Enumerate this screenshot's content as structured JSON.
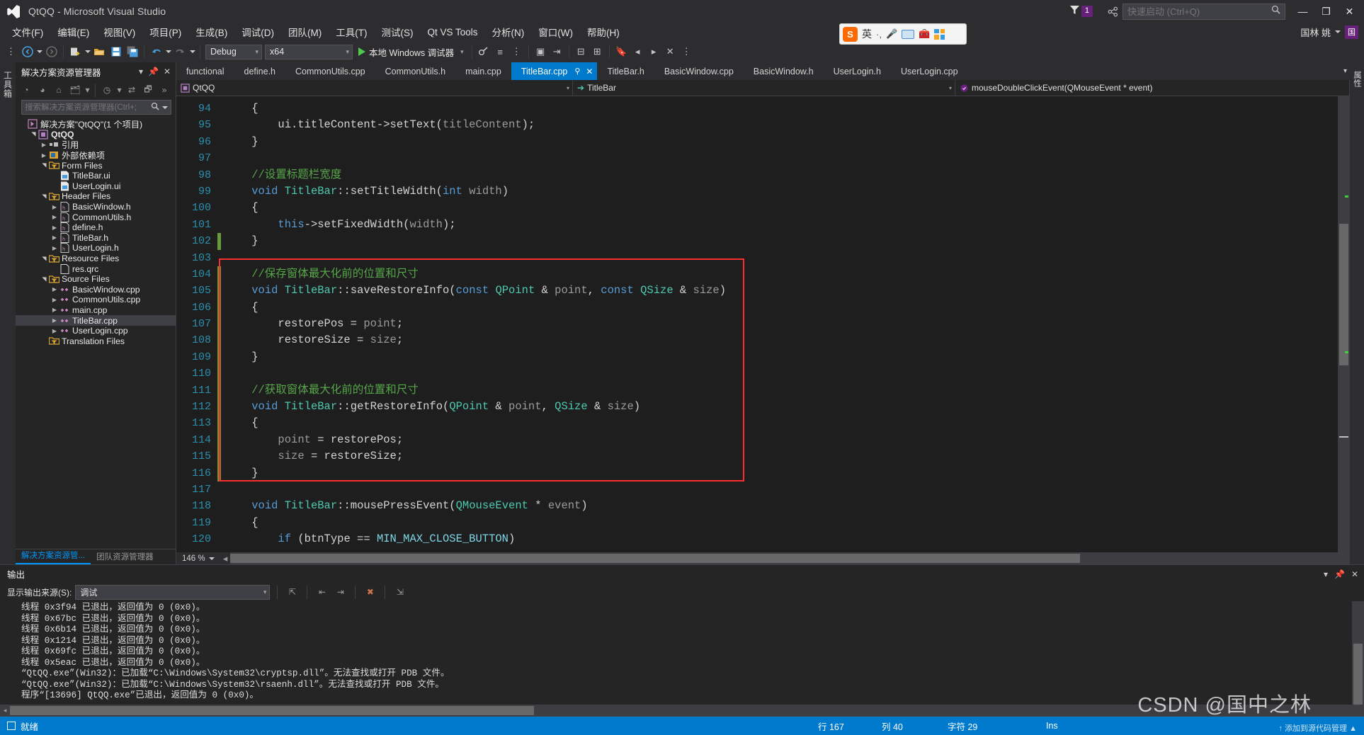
{
  "window": {
    "title": "QtQQ - Microsoft Visual Studio",
    "logo_icon": "visual-studio-logo",
    "minimize_label": "—",
    "restore_label": "❐",
    "close_label": "✕"
  },
  "notifications": {
    "icon": "feedback-flag-icon",
    "count": "1",
    "share_icon": "share-icon"
  },
  "quick_launch": {
    "placeholder": "快速启动 (Ctrl+Q)",
    "value": "",
    "icon": "search-icon"
  },
  "menu": {
    "items": [
      "文件(F)",
      "编辑(E)",
      "视图(V)",
      "项目(P)",
      "生成(B)",
      "调试(D)",
      "团队(M)",
      "工具(T)",
      "测试(S)",
      "Qt VS Tools",
      "分析(N)",
      "窗口(W)",
      "帮助(H)"
    ]
  },
  "account": {
    "name": "国林 姚",
    "avatar_initial": "国"
  },
  "toolbar": {
    "nav_back_icon": "navigate-back-icon",
    "nav_forward_icon": "navigate-forward-icon",
    "new_project_icon": "new-project-icon",
    "open_file_icon": "open-file-icon",
    "save_icon": "save-icon",
    "save_all_icon": "save-all-icon",
    "undo_icon": "undo-icon",
    "redo_icon": "redo-icon",
    "config_value": "Debug",
    "platform_value": "x64",
    "run_label": "本地 Windows 调试器",
    "run_icon": "play-icon"
  },
  "ime": {
    "engine": "搜狗输入法",
    "mode": "英",
    "logo_text": "S",
    "icons": [
      "mic-icon",
      "keyboard-icon",
      "toolbox-icon",
      "apps-icon"
    ]
  },
  "left_rail": {
    "label": "工具箱"
  },
  "right_rail": {
    "label": "属性"
  },
  "solution_explorer": {
    "title": "解决方案资源管理器",
    "header_icons": [
      "chevron-down-icon",
      "pin-icon",
      "close-icon"
    ],
    "toolbar_icons": [
      "back-icon",
      "forward-icon",
      "home-icon",
      "folder-view-icon",
      "pending-changes-icon",
      "sync-icon",
      "properties-icon",
      "overflow-icon"
    ],
    "search": {
      "placeholder": "搜索解决方案资源管理器(Ctrl+;",
      "value": "",
      "icon": "search-icon"
    },
    "tree": [
      {
        "label": "解决方案\"QtQQ\"(1 个项目)",
        "depth": 0,
        "arrow": "none",
        "icon": "solution-icon",
        "bold": false,
        "selected": false
      },
      {
        "label": "QtQQ",
        "depth": 1,
        "arrow": "open",
        "icon": "project-icon",
        "bold": true,
        "selected": false
      },
      {
        "label": "引用",
        "depth": 2,
        "arrow": "closed",
        "icon": "references-icon",
        "bold": false,
        "selected": false
      },
      {
        "label": "外部依赖项",
        "depth": 2,
        "arrow": "closed",
        "icon": "external-deps-icon",
        "bold": false,
        "selected": false
      },
      {
        "label": "Form Files",
        "depth": 2,
        "arrow": "open",
        "icon": "filter-folder-icon",
        "bold": false,
        "selected": false
      },
      {
        "label": "TitleBar.ui",
        "depth": 3,
        "arrow": "none",
        "icon": "ui-file-icon",
        "bold": false,
        "selected": false
      },
      {
        "label": "UserLogin.ui",
        "depth": 3,
        "arrow": "none",
        "icon": "ui-file-icon",
        "bold": false,
        "selected": false
      },
      {
        "label": "Header Files",
        "depth": 2,
        "arrow": "open",
        "icon": "filter-folder-icon",
        "bold": false,
        "selected": false
      },
      {
        "label": "BasicWindow.h",
        "depth": 3,
        "arrow": "closed",
        "icon": "h-file-icon",
        "bold": false,
        "selected": false
      },
      {
        "label": "CommonUtils.h",
        "depth": 3,
        "arrow": "closed",
        "icon": "h-file-icon",
        "bold": false,
        "selected": false
      },
      {
        "label": "define.h",
        "depth": 3,
        "arrow": "closed",
        "icon": "h-file-icon",
        "bold": false,
        "selected": false
      },
      {
        "label": "TitleBar.h",
        "depth": 3,
        "arrow": "closed",
        "icon": "h-file-icon",
        "bold": false,
        "selected": false
      },
      {
        "label": "UserLogin.h",
        "depth": 3,
        "arrow": "closed",
        "icon": "h-file-icon",
        "bold": false,
        "selected": false
      },
      {
        "label": "Resource Files",
        "depth": 2,
        "arrow": "open",
        "icon": "filter-folder-icon",
        "bold": false,
        "selected": false
      },
      {
        "label": "res.qrc",
        "depth": 3,
        "arrow": "none",
        "icon": "qrc-file-icon",
        "bold": false,
        "selected": false
      },
      {
        "label": "Source Files",
        "depth": 2,
        "arrow": "open",
        "icon": "filter-folder-icon",
        "bold": false,
        "selected": false
      },
      {
        "label": "BasicWindow.cpp",
        "depth": 3,
        "arrow": "closed",
        "icon": "cpp-file-icon",
        "bold": false,
        "selected": false
      },
      {
        "label": "CommonUtils.cpp",
        "depth": 3,
        "arrow": "closed",
        "icon": "cpp-file-icon",
        "bold": false,
        "selected": false
      },
      {
        "label": "main.cpp",
        "depth": 3,
        "arrow": "closed",
        "icon": "cpp-file-icon",
        "bold": false,
        "selected": false
      },
      {
        "label": "TitleBar.cpp",
        "depth": 3,
        "arrow": "closed",
        "icon": "cpp-file-icon",
        "bold": false,
        "selected": true
      },
      {
        "label": "UserLogin.cpp",
        "depth": 3,
        "arrow": "closed",
        "icon": "cpp-file-icon",
        "bold": false,
        "selected": false
      },
      {
        "label": "Translation Files",
        "depth": 2,
        "arrow": "none",
        "icon": "filter-folder-icon",
        "bold": false,
        "selected": false
      }
    ],
    "bottom_tabs": [
      {
        "label": "解决方案资源管...",
        "active": true
      },
      {
        "label": "团队资源管理器",
        "active": false
      }
    ]
  },
  "editor": {
    "tabs": [
      {
        "label": "functional",
        "active": false
      },
      {
        "label": "define.h",
        "active": false
      },
      {
        "label": "CommonUtils.cpp",
        "active": false
      },
      {
        "label": "CommonUtils.h",
        "active": false
      },
      {
        "label": "main.cpp",
        "active": false
      },
      {
        "label": "TitleBar.cpp",
        "active": true
      },
      {
        "label": "TitleBar.h",
        "active": false
      },
      {
        "label": "BasicWindow.cpp",
        "active": false
      },
      {
        "label": "BasicWindow.h",
        "active": false
      },
      {
        "label": "UserLogin.h",
        "active": false
      },
      {
        "label": "UserLogin.cpp",
        "active": false
      }
    ],
    "active_tab_pin_icon": "pin-icon",
    "active_tab_close_icon": "close-icon",
    "navbar": {
      "scope": "QtQQ",
      "scope_icon": "project-icon",
      "type": "TitleBar",
      "type_icon": "class-arrow-icon",
      "member": "mouseDoubleClickEvent(QMouseEvent * event)",
      "member_icon": "method-icon"
    },
    "zoom": "146 %",
    "first_line_number": 94,
    "lines": [
      {
        "n": 94,
        "tokens": [
          {
            "t": "    {",
            "c": "pn"
          }
        ]
      },
      {
        "n": 95,
        "tokens": [
          {
            "t": "        ui.titleContent->setText(",
            "c": "id"
          },
          {
            "t": "titleContent",
            "c": "var"
          },
          {
            "t": ");",
            "c": "pn"
          }
        ]
      },
      {
        "n": 96,
        "tokens": [
          {
            "t": "    }",
            "c": "pn"
          }
        ]
      },
      {
        "n": 97,
        "tokens": []
      },
      {
        "n": 98,
        "tokens": [
          {
            "t": "    //设置标题栏宽度",
            "c": "cmt"
          }
        ]
      },
      {
        "n": 99,
        "tokens": [
          {
            "t": "    ",
            "c": "pn"
          },
          {
            "t": "void",
            "c": "kw"
          },
          {
            "t": " ",
            "c": "pn"
          },
          {
            "t": "TitleBar",
            "c": "type"
          },
          {
            "t": "::setTitleWidth(",
            "c": "id"
          },
          {
            "t": "int",
            "c": "kw"
          },
          {
            "t": " ",
            "c": "pn"
          },
          {
            "t": "width",
            "c": "var"
          },
          {
            "t": ")",
            "c": "pn"
          }
        ],
        "fold": true
      },
      {
        "n": 100,
        "tokens": [
          {
            "t": "    {",
            "c": "pn"
          }
        ]
      },
      {
        "n": 101,
        "tokens": [
          {
            "t": "        ",
            "c": "pn"
          },
          {
            "t": "this",
            "c": "kw"
          },
          {
            "t": "->setFixedWidth(",
            "c": "id"
          },
          {
            "t": "width",
            "c": "var"
          },
          {
            "t": ");",
            "c": "pn"
          }
        ]
      },
      {
        "n": 102,
        "tokens": [
          {
            "t": "    }",
            "c": "pn"
          }
        ]
      },
      {
        "n": 103,
        "tokens": []
      },
      {
        "n": 104,
        "tokens": [
          {
            "t": "    //保存窗体最大化前的位置和尺寸",
            "c": "cmt"
          }
        ]
      },
      {
        "n": 105,
        "tokens": [
          {
            "t": "    ",
            "c": "pn"
          },
          {
            "t": "void",
            "c": "kw"
          },
          {
            "t": " ",
            "c": "pn"
          },
          {
            "t": "TitleBar",
            "c": "type"
          },
          {
            "t": "::saveRestoreInfo(",
            "c": "id"
          },
          {
            "t": "const",
            "c": "kw"
          },
          {
            "t": " ",
            "c": "pn"
          },
          {
            "t": "QPoint",
            "c": "type"
          },
          {
            "t": " & ",
            "c": "pn"
          },
          {
            "t": "point",
            "c": "var"
          },
          {
            "t": ", ",
            "c": "pn"
          },
          {
            "t": "const",
            "c": "kw"
          },
          {
            "t": " ",
            "c": "pn"
          },
          {
            "t": "QSize",
            "c": "type"
          },
          {
            "t": " & ",
            "c": "pn"
          },
          {
            "t": "size",
            "c": "var"
          },
          {
            "t": ")",
            "c": "pn"
          }
        ],
        "fold": true
      },
      {
        "n": 106,
        "tokens": [
          {
            "t": "    {",
            "c": "pn"
          }
        ]
      },
      {
        "n": 107,
        "tokens": [
          {
            "t": "        restorePos = ",
            "c": "id"
          },
          {
            "t": "point",
            "c": "var"
          },
          {
            "t": ";",
            "c": "pn"
          }
        ]
      },
      {
        "n": 108,
        "tokens": [
          {
            "t": "        restoreSize = ",
            "c": "id"
          },
          {
            "t": "size",
            "c": "var"
          },
          {
            "t": ";",
            "c": "pn"
          }
        ]
      },
      {
        "n": 109,
        "tokens": [
          {
            "t": "    }",
            "c": "pn"
          }
        ]
      },
      {
        "n": 110,
        "tokens": []
      },
      {
        "n": 111,
        "tokens": [
          {
            "t": "    //获取窗体最大化前的位置和尺寸",
            "c": "cmt"
          }
        ]
      },
      {
        "n": 112,
        "tokens": [
          {
            "t": "    ",
            "c": "pn"
          },
          {
            "t": "void",
            "c": "kw"
          },
          {
            "t": " ",
            "c": "pn"
          },
          {
            "t": "TitleBar",
            "c": "type"
          },
          {
            "t": "::getRestoreInfo(",
            "c": "id"
          },
          {
            "t": "QPoint",
            "c": "type"
          },
          {
            "t": " & ",
            "c": "pn"
          },
          {
            "t": "point",
            "c": "var"
          },
          {
            "t": ", ",
            "c": "pn"
          },
          {
            "t": "QSize",
            "c": "type"
          },
          {
            "t": " & ",
            "c": "pn"
          },
          {
            "t": "size",
            "c": "var"
          },
          {
            "t": ")",
            "c": "pn"
          }
        ],
        "fold": true
      },
      {
        "n": 113,
        "tokens": [
          {
            "t": "    {",
            "c": "pn"
          }
        ]
      },
      {
        "n": 114,
        "tokens": [
          {
            "t": "        ",
            "c": "pn"
          },
          {
            "t": "point",
            "c": "var"
          },
          {
            "t": " = restorePos;",
            "c": "id"
          }
        ]
      },
      {
        "n": 115,
        "tokens": [
          {
            "t": "        ",
            "c": "pn"
          },
          {
            "t": "size",
            "c": "var"
          },
          {
            "t": " = restoreSize;",
            "c": "id"
          }
        ]
      },
      {
        "n": 116,
        "tokens": [
          {
            "t": "    }",
            "c": "pn"
          }
        ]
      },
      {
        "n": 117,
        "tokens": []
      },
      {
        "n": 118,
        "tokens": [
          {
            "t": "    ",
            "c": "pn"
          },
          {
            "t": "void",
            "c": "kw"
          },
          {
            "t": " ",
            "c": "pn"
          },
          {
            "t": "TitleBar",
            "c": "type"
          },
          {
            "t": "::mousePressEvent(",
            "c": "id"
          },
          {
            "t": "QMouseEvent",
            "c": "type"
          },
          {
            "t": " * ",
            "c": "pn"
          },
          {
            "t": "event",
            "c": "var"
          },
          {
            "t": ")",
            "c": "pn"
          }
        ],
        "fold": true
      },
      {
        "n": 119,
        "tokens": [
          {
            "t": "    {",
            "c": "pn"
          }
        ]
      },
      {
        "n": 120,
        "tokens": [
          {
            "t": "        ",
            "c": "pn"
          },
          {
            "t": "if",
            "c": "kw"
          },
          {
            "t": " (btnType == ",
            "c": "id"
          },
          {
            "t": "MIN_MAX_CLOSE_BUTTON",
            "c": "mac"
          },
          {
            "t": ")",
            "c": "pn"
          }
        ],
        "fold": true
      }
    ]
  },
  "output": {
    "title": "输出",
    "header_icons": [
      "chevron-down-icon",
      "pin-icon",
      "close-icon"
    ],
    "source_label": "显示输出来源(S):",
    "source_value": "调试",
    "toolbar_icons": [
      "find-message-icon",
      "prev-message-icon",
      "next-message-icon",
      "clear-all-icon",
      "toggle-wordwrap-icon"
    ],
    "lines": [
      "线程 0x3f94 已退出，返回值为 0 (0x0)。",
      "线程 0x67bc 已退出，返回值为 0 (0x0)。",
      "线程 0x6b14 已退出，返回值为 0 (0x0)。",
      "线程 0x1214 已退出，返回值为 0 (0x0)。",
      "线程 0x69fc 已退出，返回值为 0 (0x0)。",
      "线程 0x5eac 已退出，返回值为 0 (0x0)。",
      "“QtQQ.exe”(Win32)：已加载“C:\\Windows\\System32\\cryptsp.dll”。无法查找或打开 PDB 文件。",
      "“QtQQ.exe”(Win32)：已加载“C:\\Windows\\System32\\rsaenh.dll”。无法查找或打开 PDB 文件。",
      "程序“[13696] QtQQ.exe”已退出，返回值为 0 (0x0)。"
    ]
  },
  "statusbar": {
    "ready": "就绪",
    "line_label": "行 167",
    "col_label": "列 40",
    "char_label": "字符 29",
    "insert_label": "Ins",
    "add_to_source_control": "↑ 添加到源代码管理 ▲"
  },
  "watermark": {
    "text": "CSDN @国中之林"
  },
  "colors": {
    "accent": "#007acc",
    "titlebar_bg": "#2d2d30",
    "editor_bg": "#1e1e1e",
    "panel_bg": "#252526",
    "highlight_box": "#ff2d2d",
    "comment_green": "#57a64a",
    "keyword_blue": "#569cd6",
    "type_teal": "#4ec9b0",
    "linenum_blue": "#2b91af"
  }
}
